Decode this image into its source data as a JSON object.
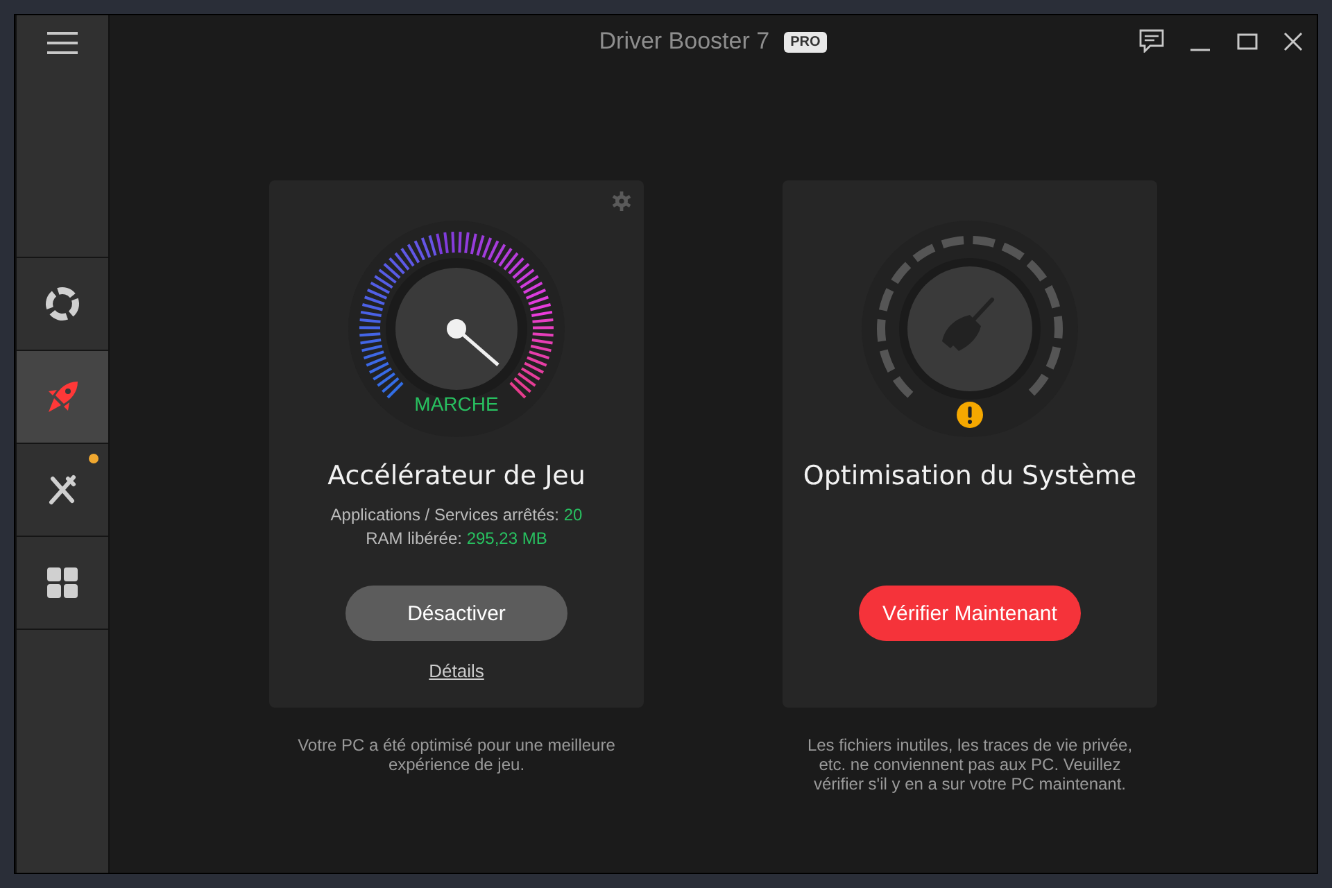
{
  "window": {
    "title": "Driver Booster 7",
    "badge": "PRO"
  },
  "sidebar": {
    "items": [
      {
        "kind": "lifebuoy",
        "selected": false,
        "dot": false
      },
      {
        "kind": "rocket",
        "selected": true,
        "dot": false
      },
      {
        "kind": "tools",
        "selected": false,
        "dot": true
      },
      {
        "kind": "apps",
        "selected": false,
        "dot": false
      }
    ]
  },
  "cards": [
    {
      "kind": "gauge",
      "status": "MARCHE",
      "title": "Accélérateur de Jeu",
      "stats": [
        {
          "label": "Applications / Services arrêtés:",
          "value": "20"
        },
        {
          "label": "RAM libérée:",
          "value": "295,23 MB"
        }
      ],
      "button": "Désactiver",
      "link": "Détails",
      "caption": "Votre PC a été optimisé pour une meilleure expérience de jeu."
    },
    {
      "kind": "cleaner",
      "warning": true,
      "title": "Optimisation du Système",
      "button": "Vérifier Maintenant",
      "caption": "Les fichiers inutiles, les traces de vie privée, etc. ne conviennent pas aux PC. Veuillez vérifier s'il y en a sur votre PC maintenant."
    }
  ]
}
